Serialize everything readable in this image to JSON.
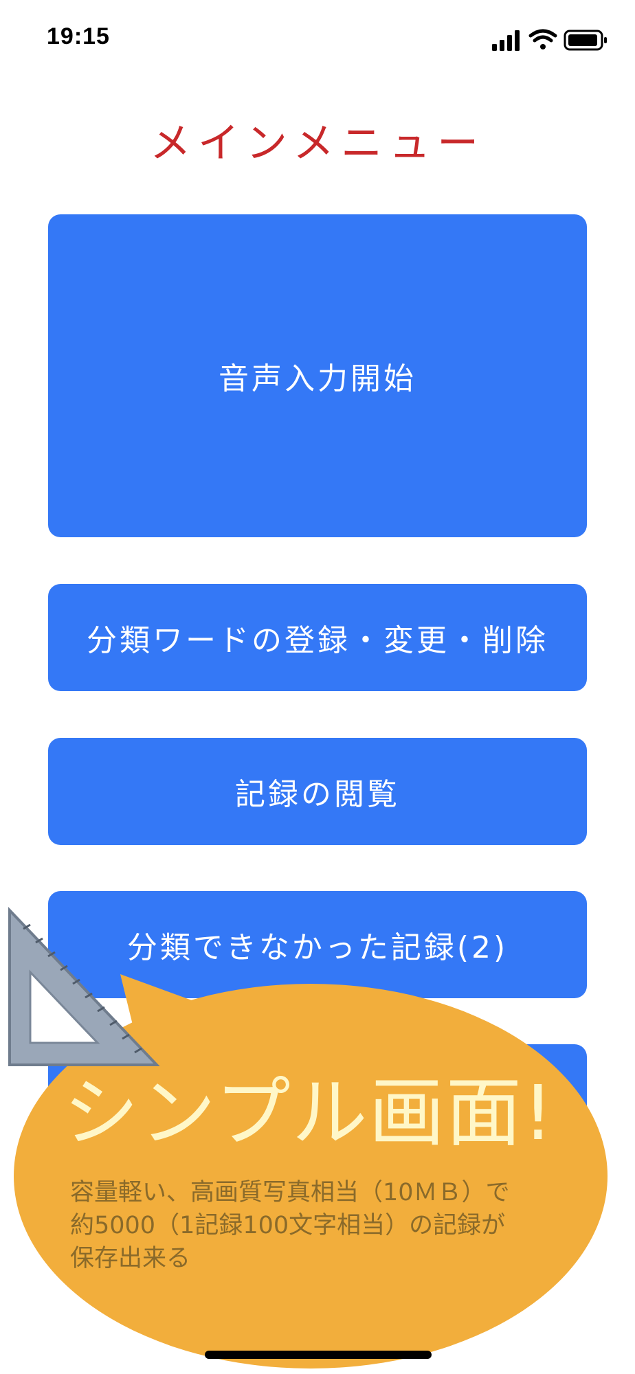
{
  "status_bar": {
    "time": "19:15",
    "icons": [
      "cellular-signal-icon",
      "wifi-icon",
      "battery-icon"
    ]
  },
  "title": "メインメニュー",
  "menu": {
    "start_voice_input": "音声入力開始",
    "manage_words": "分類ワードの登録・変更・削除",
    "view_records": "記録の閲覧",
    "unclassified": "分類できなかった記録(2)",
    "hidden_button": ""
  },
  "callout": {
    "title": "シンプル画面!",
    "lines": [
      "容量軽い、高画質写真相当（10ＭＢ）で",
      "約5000（1記録100文字相当）の記録が",
      "保存出来る"
    ],
    "icon": "triangle-ruler-icon",
    "color": "#f2ae3c"
  },
  "colors": {
    "accent": "#3478f6",
    "title": "#c8282a",
    "callout_fill": "#f2ae3c",
    "callout_text": "#fff7c8"
  }
}
